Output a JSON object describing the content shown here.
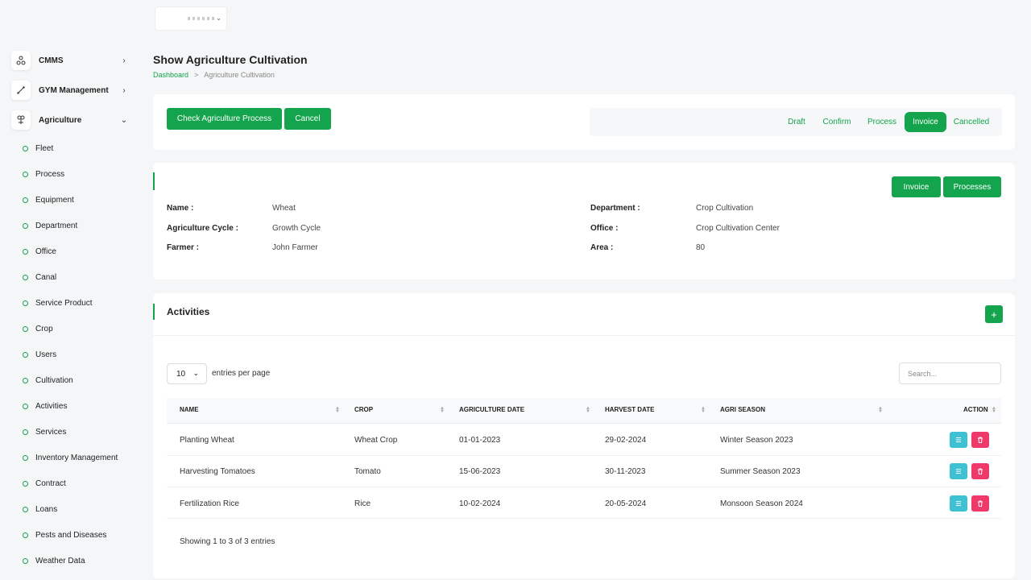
{
  "sidebar": {
    "main": [
      {
        "label": "CMMS",
        "icon": "cmms-icon",
        "arrow": "›"
      },
      {
        "label": "GYM Management",
        "icon": "gym-icon",
        "arrow": "›"
      },
      {
        "label": "Agriculture",
        "icon": "agriculture-icon",
        "arrow": "⌄"
      }
    ],
    "sub": [
      "Fleet",
      "Process",
      "Equipment",
      "Department",
      "Office",
      "Canal",
      "Service Product",
      "Crop",
      "Users",
      "Cultivation",
      "Activities",
      "Services",
      "Inventory Management",
      "Contract",
      "Loans",
      "Pests and Diseases",
      "Weather Data"
    ]
  },
  "header": {
    "title": "Show Agriculture Cultivation",
    "breadcrumb_home": "Dashboard",
    "breadcrumb_sep": ">",
    "breadcrumb_current": "Agriculture Cultivation"
  },
  "actions": {
    "check_label": "Check Agriculture Process",
    "cancel_label": "Cancel"
  },
  "status": {
    "steps": [
      "Draft",
      "Confirm",
      "Process",
      "Invoice",
      "Cancelled"
    ],
    "active": "Invoice"
  },
  "details": {
    "invoice_label": "Invoice",
    "processes_label": "Processes",
    "left": [
      {
        "key": "Name :",
        "value": "Wheat"
      },
      {
        "key": "Agriculture Cycle :",
        "value": "Growth Cycle"
      },
      {
        "key": "Farmer :",
        "value": "John Farmer"
      }
    ],
    "right": [
      {
        "key": "Department :",
        "value": "Crop Cultivation"
      },
      {
        "key": "Office :",
        "value": "Crop Cultivation Center"
      },
      {
        "key": "Area :",
        "value": "80"
      }
    ]
  },
  "activities": {
    "title": "Activities",
    "add_label": "+",
    "entries_value": "10",
    "entries_label": "entries per page",
    "search_placeholder": "Search...",
    "columns": [
      "NAME",
      "CROP",
      "AGRICULTURE DATE",
      "HARVEST DATE",
      "AGRI SEASON",
      "ACTION"
    ],
    "rows": [
      [
        "Planting Wheat",
        "Wheat Crop",
        "01-01-2023",
        "29-02-2024",
        "Winter Season 2023"
      ],
      [
        "Harvesting Tomatoes",
        "Tomato",
        "15-06-2023",
        "30-11-2023",
        "Summer Season 2023"
      ],
      [
        "Fertilization Rice",
        "Rice",
        "10-02-2024",
        "20-05-2024",
        "Monsoon Season 2024"
      ]
    ],
    "showing": "Showing 1 to 3 of 3 entries"
  },
  "colors": {
    "accent": "#14a44d",
    "view": "#3ec1d3",
    "delete": "#f0396b"
  }
}
